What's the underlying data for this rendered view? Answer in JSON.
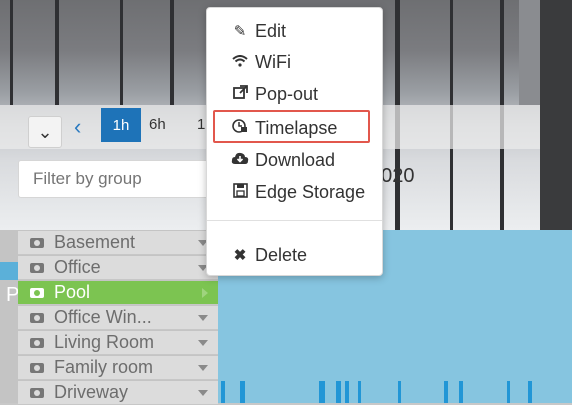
{
  "colors": {
    "accent_blue": "#1e73b8",
    "active_green": "#7cc451",
    "timeline_blue": "#86c5e0",
    "highlight_red": "#e2574c"
  },
  "toolbar": {
    "collapse_icon": "chevron-down-icon",
    "back_icon": "chevron-left-icon",
    "range_1h": "1h",
    "range_6h": "6h",
    "range_partial": "1"
  },
  "filter": {
    "placeholder": "Filter by group",
    "value": ""
  },
  "date_fragment": "2020",
  "timeline_left_letter": "P",
  "context_menu": {
    "items": [
      {
        "label": "Edit",
        "icon": "pencil-icon"
      },
      {
        "label": "WiFi",
        "icon": "wifi-icon"
      },
      {
        "label": "Pop-out",
        "icon": "external-link-icon"
      },
      {
        "label": "Timelapse",
        "icon": "timelapse-icon",
        "highlighted": true
      },
      {
        "label": "Download",
        "icon": "cloud-download-icon"
      },
      {
        "label": "Edge Storage",
        "icon": "save-icon"
      },
      {
        "label": "Delete",
        "icon": "close-icon"
      }
    ]
  },
  "cameras": [
    {
      "label": "Basement",
      "active": false
    },
    {
      "label": "Office",
      "active": false
    },
    {
      "label": "Pool",
      "active": true
    },
    {
      "label": "Office Win...",
      "active": false
    },
    {
      "label": "Living Room",
      "active": false
    },
    {
      "label": "Family room",
      "active": false
    },
    {
      "label": "Driveway",
      "active": false
    }
  ]
}
